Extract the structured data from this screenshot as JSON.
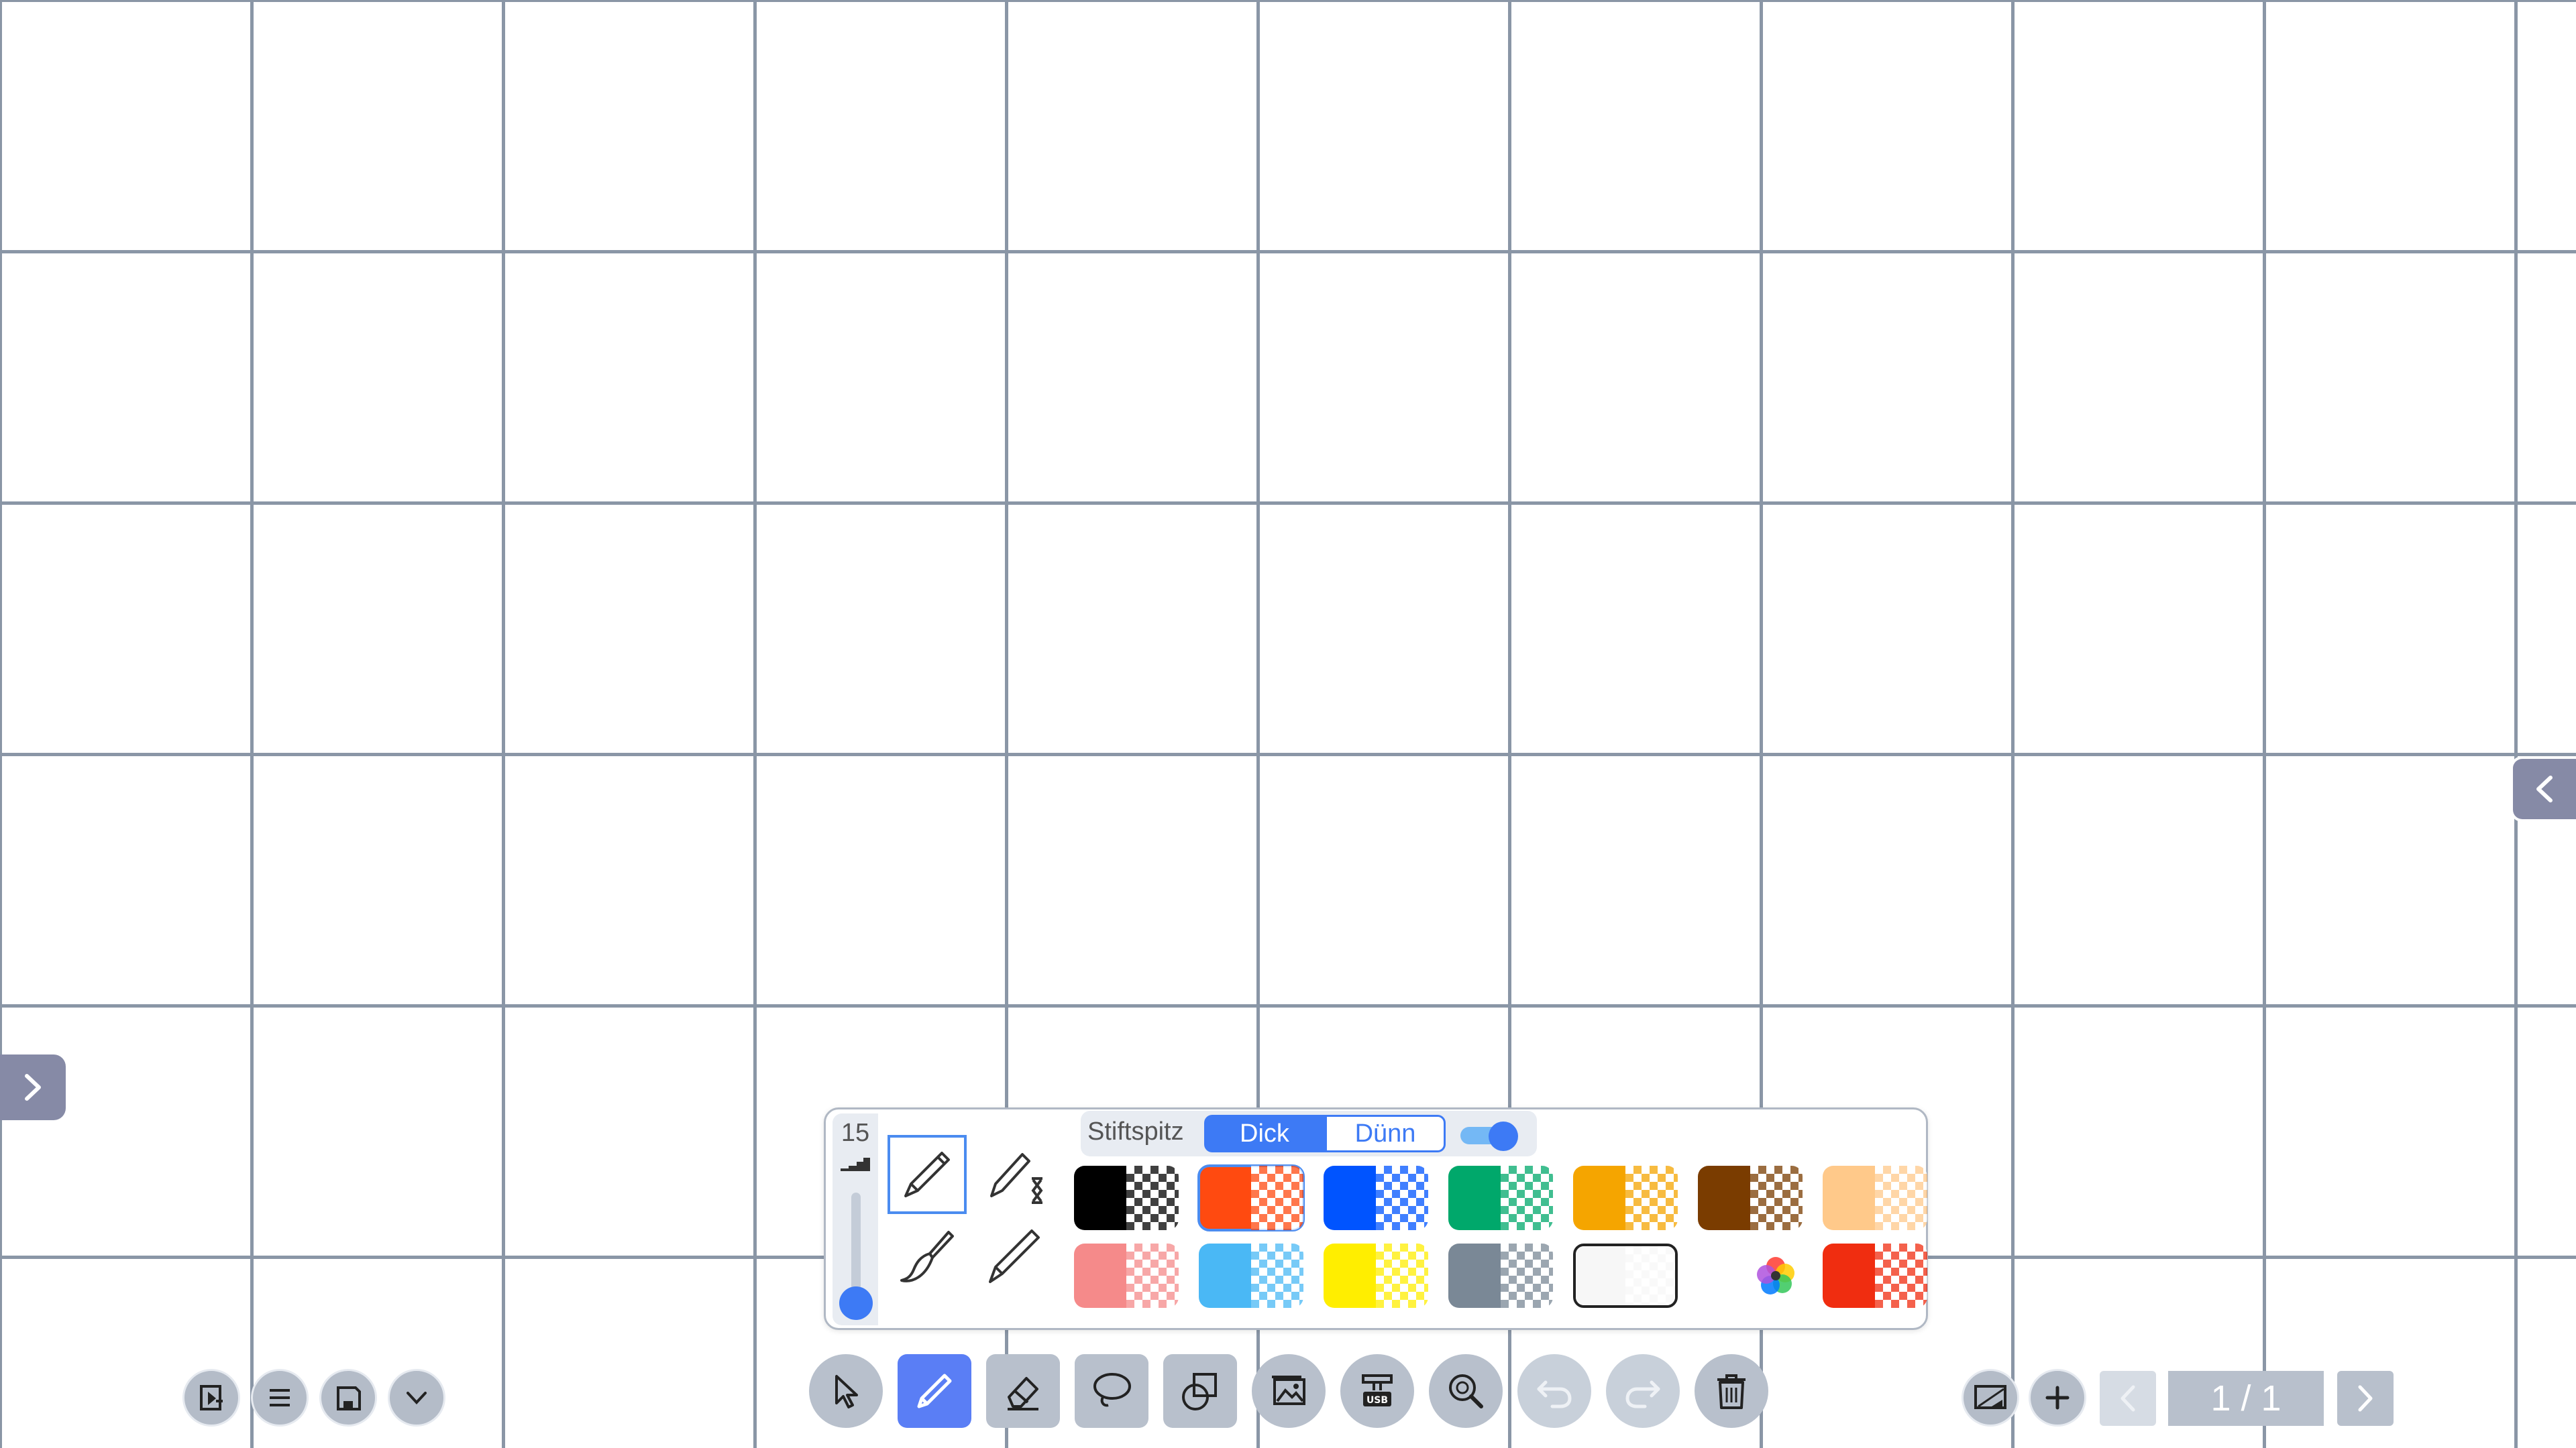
{
  "pen_panel": {
    "thickness": "15",
    "tip_label": "Stiftspitz",
    "tip_options": [
      "Dick",
      "Dünn"
    ],
    "tip_selected": "Dick",
    "toggle_on": true,
    "slider_level": 0.1,
    "pens": [
      "pen-icon",
      "pen-hourglass-icon",
      "brush-icon",
      "calligraphy-pen-icon"
    ],
    "selected_pen": "pen-icon",
    "colors_row1": [
      "#000000",
      "#ff4a10",
      "#0054ff",
      "#00a86b",
      "#f5a500",
      "#7a3c00",
      "#ffc98a"
    ],
    "colors_row2": [
      "#f58a8a",
      "#4ab8f5",
      "#ffee00",
      "#7a8896",
      "#f7f7f7",
      "color-wheel-icon",
      "#f02d10"
    ],
    "selected_color": "#ff4a10"
  },
  "toolbar": {
    "tools": [
      "select-icon",
      "pen-icon",
      "eraser-icon",
      "lasso-icon",
      "shape-icon",
      "image-icon",
      "usb-icon",
      "zoom-icon",
      "undo-icon",
      "redo-icon",
      "trash-icon"
    ],
    "active_tool": "pen-icon"
  },
  "left_controls": [
    "exit-icon",
    "menu-icon",
    "save-icon",
    "chevron-down-icon"
  ],
  "pagination": {
    "label": "1 / 1",
    "buttons": [
      "screen-icon",
      "add-page-icon",
      "prev-page-icon",
      "next-page-icon"
    ]
  },
  "side_tabs": [
    "expand-right-icon",
    "expand-left-icon"
  ]
}
